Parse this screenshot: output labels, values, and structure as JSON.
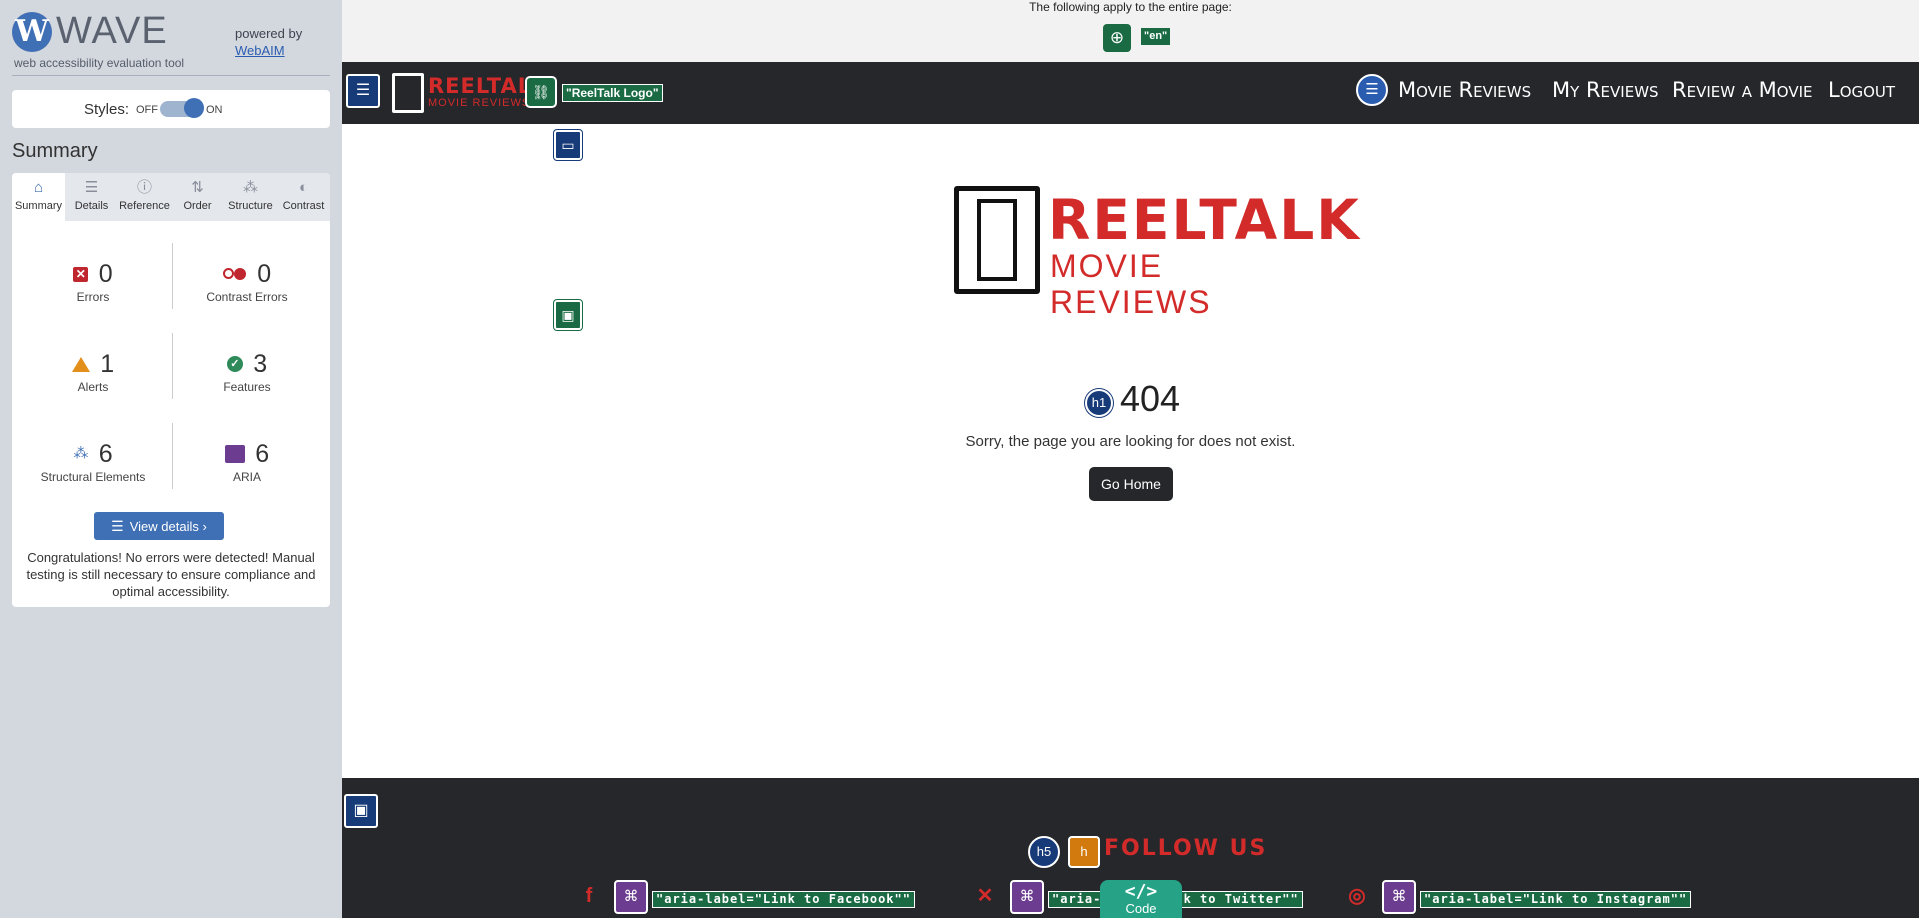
{
  "wave": {
    "logo_letter": "W",
    "title": "WAVE",
    "subtitle": "web accessibility evaluation tool",
    "powered_by": "powered by",
    "powered_link": "WebAIM",
    "styles_label": "Styles:",
    "styles_off": "OFF",
    "styles_on": "ON",
    "summary_title": "Summary",
    "tabs": [
      {
        "label": "Summary",
        "icon": "home-icon",
        "glyph": "⌂"
      },
      {
        "label": "Details",
        "icon": "list-icon",
        "glyph": "☰"
      },
      {
        "label": "Reference",
        "icon": "info-icon",
        "glyph": "ⓘ"
      },
      {
        "label": "Order",
        "icon": "order-icon",
        "glyph": "⇅"
      },
      {
        "label": "Structure",
        "icon": "structure-icon",
        "glyph": "⁂"
      },
      {
        "label": "Contrast",
        "icon": "contrast-icon",
        "glyph": "◐"
      }
    ],
    "stats": {
      "errors": {
        "value": "0",
        "label": "Errors",
        "glyph": "✕"
      },
      "contrast_errors": {
        "value": "0",
        "label": "Contrast Errors"
      },
      "alerts": {
        "value": "1",
        "label": "Alerts"
      },
      "features": {
        "value": "3",
        "label": "Features",
        "glyph": "✓"
      },
      "structural": {
        "value": "6",
        "label": "Structural Elements",
        "glyph": "⁂"
      },
      "aria": {
        "value": "6",
        "label": "ARIA"
      }
    },
    "view_details": "View details ›",
    "view_details_glyph": "☰",
    "congrats": "Congratulations! No errors were detected! Manual testing is still necessary to ensure compliance and optimal accessibility."
  },
  "page": {
    "top_notice": "The following apply to the entire page:",
    "globe_glyph": "⊕",
    "lang_tag": "\"en\"",
    "nav": {
      "logo_text_main": "REELTALK",
      "logo_text_sub": "MOVIE REVIEWS",
      "landmark_glyph": "☰",
      "link_glyph": "⛓",
      "logo_alt": "\"ReelTalk Logo\"",
      "list_glyph": "☰",
      "links": [
        "Movie Reviews",
        "My Reviews",
        "Review a Movie",
        "Logout"
      ]
    },
    "main_glyph": "▭",
    "image_glyph": "▣",
    "hero_text_main": "REELTALK",
    "hero_text_sub": "MOVIE REVIEWS",
    "h1_badge": "h1",
    "heading": "404",
    "message": "Sorry, the page you are looking for does not exist.",
    "button": "Go Home",
    "footer": {
      "landmark_glyph": "▣",
      "h5_badge": "h5",
      "alert_badge": "h",
      "heading": "FOLLOW US",
      "tag_glyph": "⌘",
      "social": [
        {
          "name": "facebook-icon",
          "glyph": "f",
          "aria": "\"aria-label=\"Link to Facebook\"\""
        },
        {
          "name": "x-icon",
          "glyph": "✕",
          "aria": "\"aria-label=\"Link to Twitter\"\""
        },
        {
          "name": "instagram-icon",
          "glyph": "◎",
          "aria": "\"aria-label=\"Link to Instagram\"\""
        }
      ]
    },
    "code_glyph": "</>",
    "code_label": "Code"
  },
  "colors": {
    "wave_blue": "#3f6fb4",
    "error_red": "#c0262d",
    "alert_orange": "#e2901b",
    "feature_green": "#2f8a5a",
    "aria_purple": "#6b3c8f",
    "brand_red": "#d32a2a",
    "nav_dark": "#25272b",
    "code_teal": "#26a386"
  }
}
